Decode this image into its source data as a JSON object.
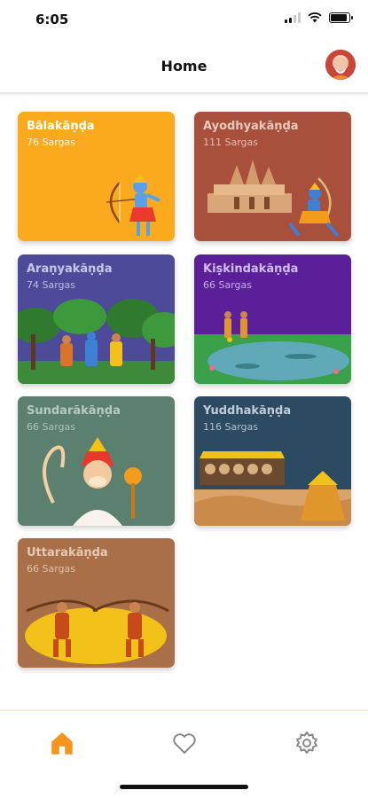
{
  "status_bar": {
    "time": "6:05"
  },
  "header": {
    "title": "Home"
  },
  "cards": [
    {
      "title": "Bālakāṇḍa",
      "subtitle": "76 Sargas",
      "color": "#fcaa1d"
    },
    {
      "title": "Ayodhyakāṇḍa",
      "subtitle": "111 Sargas",
      "color": "#a8503c"
    },
    {
      "title": "Araṇyakāṇḍa",
      "subtitle": "74 Sargas",
      "color": "#4e4a9a"
    },
    {
      "title": "Kiṣkindakāṇḍa",
      "subtitle": "66 Sargas",
      "color": "#5a1f99"
    },
    {
      "title": "Sundarākāṇḍa",
      "subtitle": "66 Sargas",
      "color": "#5c8070"
    },
    {
      "title": "Yuddhakāṇḍa",
      "subtitle": "116 Sargas",
      "color": "#2d4a63"
    },
    {
      "title": "Uttarakāṇḍa",
      "subtitle": "66 Sargas",
      "color": "#a86f48"
    }
  ],
  "tabbar": {
    "active_color": "#f7941d",
    "inactive_color": "#8a8a8a",
    "tabs": [
      {
        "icon": "home-icon",
        "active": true
      },
      {
        "icon": "heart-icon",
        "active": false
      },
      {
        "icon": "gear-icon",
        "active": false
      }
    ]
  }
}
